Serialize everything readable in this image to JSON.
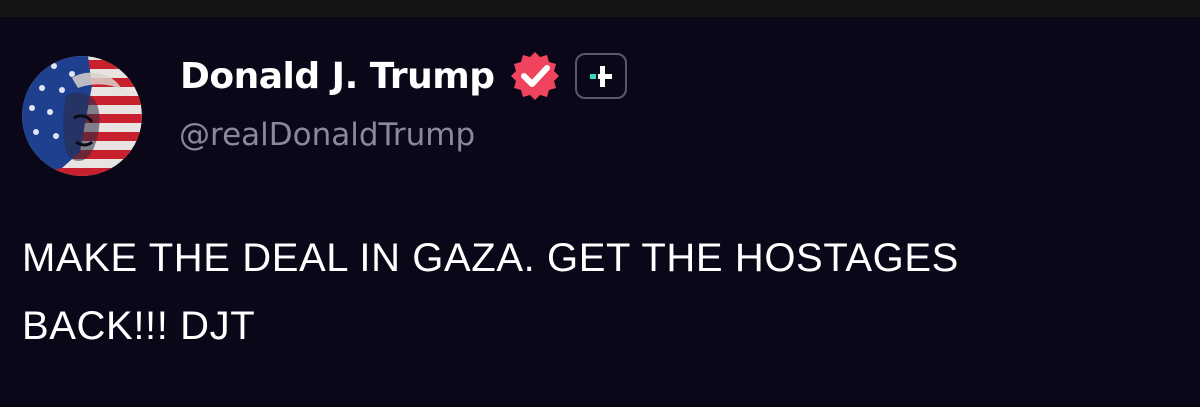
{
  "author": {
    "display_name": "Donald J. Trump",
    "handle": "@realDonaldTrump",
    "avatar_icon": "flag-portrait-avatar",
    "verified_icon": "verified-check-icon",
    "verified_color": "#f0445e",
    "plus_icon": "plus-badge-icon",
    "plus_color": "#3dd6c1"
  },
  "post": {
    "lines": [
      "MAKE THE DEAL IN GAZA. GET THE HOSTAGES",
      "BACK!!! DJT"
    ]
  },
  "colors": {
    "background": "#0a0818",
    "handle_text": "#8b8898"
  }
}
